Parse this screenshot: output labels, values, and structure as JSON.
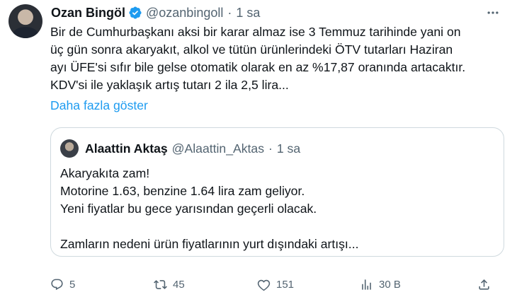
{
  "tweet": {
    "author_name": "Ozan Bingöl",
    "handle": "@ozanbingoll",
    "separator": "·",
    "time": "1 sa",
    "text_lines": [
      "Bir de Cumhurbaşkanı aksi bir karar almaz ise 3 Temmuz tarihinde yani on",
      "üç gün sonra akaryakıt, alkol ve tütün ürünlerindeki ÖTV tutarları Haziran",
      "ayı ÜFE'si sıfır bile gelse otomatik olarak en az %17,87 oranında artacaktır.",
      "KDV'si ile yaklaşık artış tutarı 2 ila 2,5 lira..."
    ],
    "show_more": "Daha fazla göster",
    "more_icon": "ellipsis-icon"
  },
  "quoted_tweet": {
    "author_name": "Alaattin Aktaş",
    "handle": "@Alaattin_Aktas",
    "separator": "·",
    "time": "1 sa",
    "text_lines": [
      "Akaryakıta zam!",
      "Motorine 1.63, benzine 1.64 lira zam geliyor.",
      "Yeni fiyatlar bu gece yarısından geçerli olacak."
    ],
    "text_paragraph_2": "Zamların nedeni ürün fiyatlarının yurt dışındaki artışı..."
  },
  "actions": {
    "reply_count": "5",
    "repost_count": "45",
    "like_count": "151",
    "views_count": "30 B"
  },
  "colors": {
    "text": "#0f1419",
    "secondary": "#536471",
    "link": "#1d9bf0",
    "verified": "#1d9bf0",
    "border": "#cfd9de"
  }
}
